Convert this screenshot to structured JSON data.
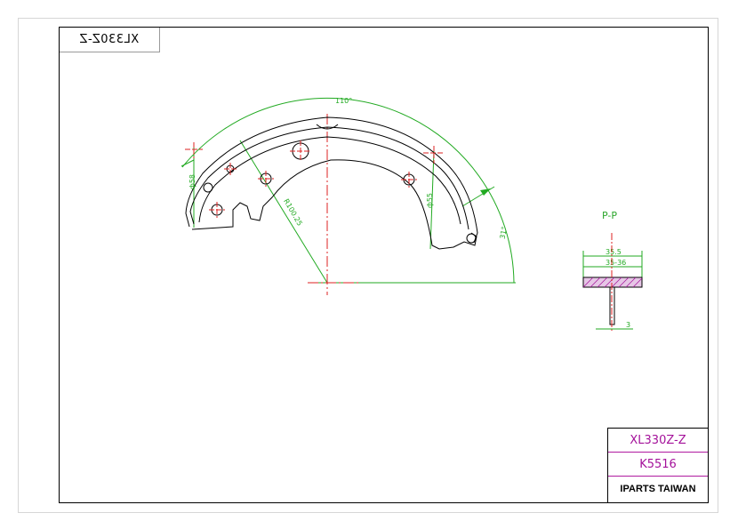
{
  "drawing": {
    "mirrored_tag": "XL330Z-Z",
    "section_label": "P-P",
    "angle_top": "110°",
    "angle_right": "31°",
    "dim_left": "ф58",
    "dim_mid": "ф55",
    "dim_radius": "R100.25",
    "section_width_outer": "35.5",
    "section_width_inner": "35-36",
    "web_thickness": "3"
  },
  "title_block": {
    "part_no": "XL330Z-Z",
    "ref_no": "K5516",
    "company": "IPARTS TAIWAN"
  },
  "colors": {
    "dimension": "#22aa22",
    "centerline": "#dd2222",
    "outline": "#000000",
    "lining": "#a4119a"
  }
}
